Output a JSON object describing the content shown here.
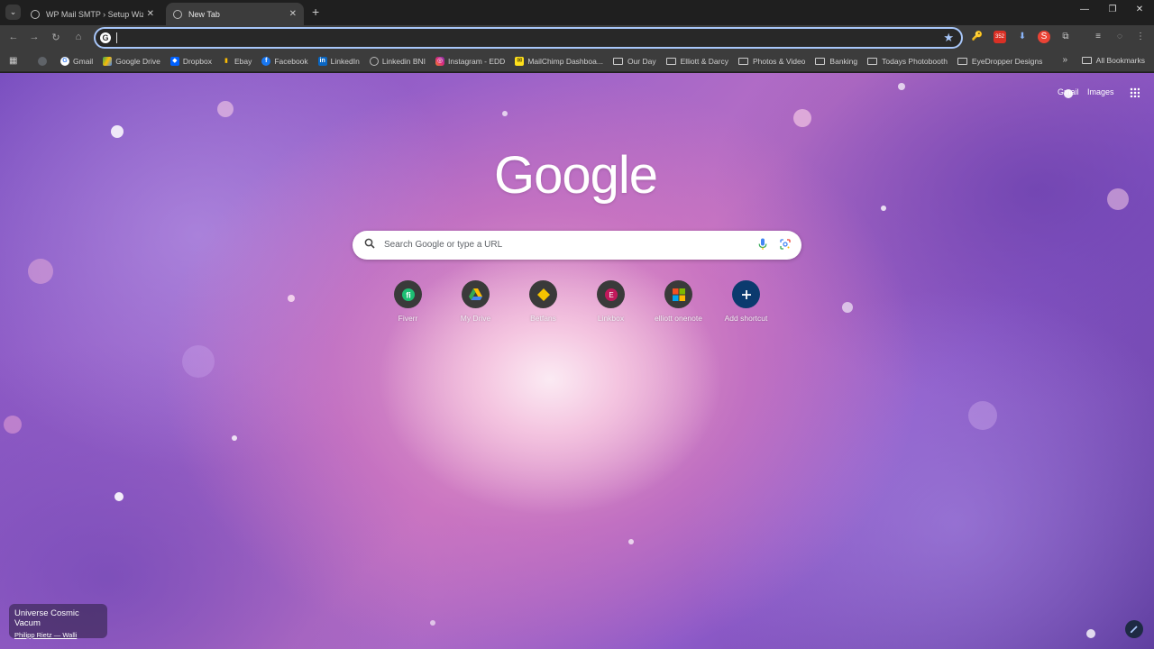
{
  "tabs": [
    {
      "title": "WP Mail SMTP › Setup Wizard",
      "active": false
    },
    {
      "title": "New Tab",
      "active": true
    }
  ],
  "toolbar": {
    "extensions": [
      {
        "icon": "key-icon",
        "color": "#f29900"
      },
      {
        "icon": "calendar-badge-icon",
        "color": "#d93025",
        "badge": "352"
      },
      {
        "icon": "download-icon",
        "color": "#8ab4f8"
      },
      {
        "icon": "extension-red-icon",
        "color": "#ea4335"
      },
      {
        "icon": "puzzle-icon",
        "color": "#cccccc"
      },
      {
        "icon": "media-queue-icon",
        "color": "#cccccc"
      },
      {
        "icon": "profile-icon",
        "color": "#aaaaaa"
      },
      {
        "icon": "menu-icon",
        "color": "#cccccc"
      }
    ]
  },
  "bookmarks": {
    "items": [
      {
        "label": "",
        "icon": "chromium-icon",
        "color": "#9aa0a6"
      },
      {
        "label": "Gmail",
        "icon": "google-g-icon",
        "color": "#ffffff"
      },
      {
        "label": "Google Drive",
        "icon": "drive-icon",
        "color": "#34a853"
      },
      {
        "label": "Dropbox",
        "icon": "dropbox-icon",
        "color": "#0061ff"
      },
      {
        "label": "Ebay",
        "icon": "ebay-icon",
        "color": "#e53238"
      },
      {
        "label": "Facebook",
        "icon": "facebook-icon",
        "color": "#1877f2"
      },
      {
        "label": "LinkedIn",
        "icon": "linkedin-icon",
        "color": "#0a66c2"
      },
      {
        "label": "Linkedin BNI",
        "icon": "globe-icon",
        "color": "#9aa0a6"
      },
      {
        "label": "Instagram - EDD",
        "icon": "instagram-icon",
        "color": "#e1306c"
      },
      {
        "label": "MailChimp Dashboa...",
        "icon": "mailchimp-icon",
        "color": "#ffe01b"
      },
      {
        "label": "Our Day",
        "icon": "folder-icon"
      },
      {
        "label": "Elliott & Darcy",
        "icon": "folder-icon"
      },
      {
        "label": "Photos & Video",
        "icon": "folder-icon"
      },
      {
        "label": "Banking",
        "icon": "folder-icon"
      },
      {
        "label": "Todays Photobooth",
        "icon": "folder-icon"
      },
      {
        "label": "EyeDropper Designs",
        "icon": "folder-icon"
      }
    ],
    "more": "»",
    "all_label": "All Bookmarks"
  },
  "ntp": {
    "gmail": "Gmail",
    "images": "Images",
    "logo": "Google",
    "search_placeholder": "Search Google or type a URL",
    "shortcuts": [
      {
        "label": "Fiverr",
        "icon": "fiverr-icon",
        "color": "#1dbf73"
      },
      {
        "label": "My Drive",
        "icon": "drive-icon",
        "color": "#34a853"
      },
      {
        "label": "Betfans",
        "icon": "betfans-icon",
        "color": "#f5c400"
      },
      {
        "label": "Linkbox",
        "icon": "linkbox-icon",
        "color": "#c2185b"
      },
      {
        "label": "elliott onenote",
        "icon": "microsoft-icon",
        "color": "#f25022"
      },
      {
        "label": "Add shortcut",
        "icon": "plus-icon",
        "color": "#0b57d0"
      }
    ],
    "attribution_title": "Universe Cosmic Vacum",
    "attribution_author": "Philipp Rietz — Walli"
  }
}
